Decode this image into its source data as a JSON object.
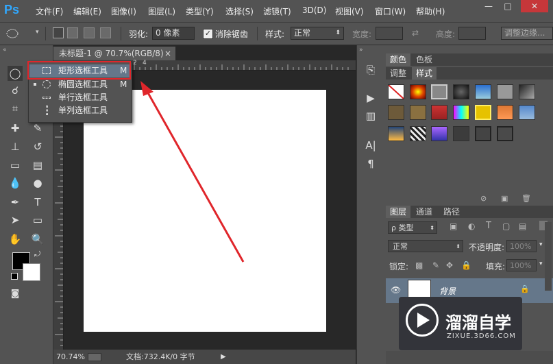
{
  "app": {
    "logo": "Ps"
  },
  "menu": [
    "文件(F)",
    "编辑(E)",
    "图像(I)",
    "图层(L)",
    "类型(Y)",
    "选择(S)",
    "滤镜(T)",
    "3D(D)",
    "视图(V)",
    "窗口(W)",
    "帮助(H)"
  ],
  "window_controls": {
    "minimize": "—",
    "maximize": "□",
    "close": "✕"
  },
  "options": {
    "feather_label": "羽化:",
    "feather_value": "0 像素",
    "antialias_label": "消除锯齿",
    "style_label": "样式:",
    "style_value": "正常",
    "width_label": "宽度:",
    "height_label": "高度:",
    "refine_edge": "调整边缘..."
  },
  "document": {
    "tab_title": "未标题-1 @ 70.7%(RGB/8)",
    "tab_close": "×",
    "ruler_marks": [
      "2",
      "0",
      "2",
      "4"
    ],
    "zoom": "70.74%",
    "status": "文档:732.4K/0 字节"
  },
  "flyout": {
    "items": [
      {
        "label": "矩形选框工具",
        "shortcut": "M",
        "selected": true
      },
      {
        "label": "椭圆选框工具",
        "shortcut": "M",
        "selected": false
      },
      {
        "label": "单行选框工具",
        "shortcut": "",
        "selected": false
      },
      {
        "label": "单列选框工具",
        "shortcut": "",
        "selected": false
      }
    ]
  },
  "panels": {
    "color_tabs": [
      "颜色",
      "色板"
    ],
    "adjust_tabs": [
      "调整",
      "样式"
    ],
    "layer_tabs": [
      "图层",
      "通道",
      "路径"
    ],
    "kind_filter": "ρ 类型",
    "blend_mode": "正常",
    "opacity_label": "不透明度:",
    "opacity_value": "100%",
    "lock_label": "锁定:",
    "fill_label": "填充:",
    "fill_value": "100%",
    "layer_name": "背景"
  },
  "watermark": {
    "title": "溜溜自学",
    "url": "ZIXUE.3D66.COM"
  },
  "colors": {
    "accent_red": "#e0262b",
    "highlight": "#65778a",
    "ps_blue": "#31a8ff"
  }
}
